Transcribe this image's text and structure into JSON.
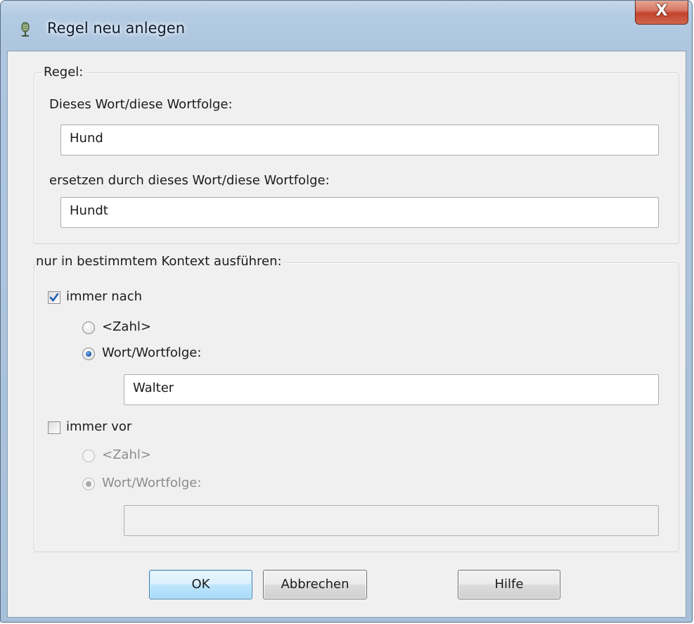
{
  "window": {
    "title": "Regel neu anlegen",
    "close_label": "X",
    "app_icon": "microphone-icon"
  },
  "rule": {
    "group_label": "Regel:",
    "find_label": "Dieses Wort/diese Wortfolge:",
    "find_value": "Hund",
    "replace_label": "ersetzen durch dieses Wort/diese Wortfolge:",
    "replace_value": "Hundt"
  },
  "context": {
    "group_label": "nur in bestimmtem Kontext ausführen:",
    "after": {
      "label": "immer nach",
      "checked": true,
      "options": [
        "<Zahl>",
        "Wort/Wortfolge:"
      ],
      "selected": "Wort/Wortfolge:",
      "value": "Walter"
    },
    "before": {
      "label": "immer vor",
      "checked": false,
      "options": [
        "<Zahl>",
        "Wort/Wortfolge:"
      ],
      "selected": "Wort/Wortfolge:",
      "value": ""
    }
  },
  "buttons": {
    "ok": "OK",
    "cancel": "Abbrechen",
    "help": "Hilfe"
  },
  "colors": {
    "frame": "#aec6df",
    "client": "#f0f0f0",
    "close_button": "#c4432c",
    "default_button_border": "#3c7fb1",
    "check_accent": "#1f5fb4"
  }
}
